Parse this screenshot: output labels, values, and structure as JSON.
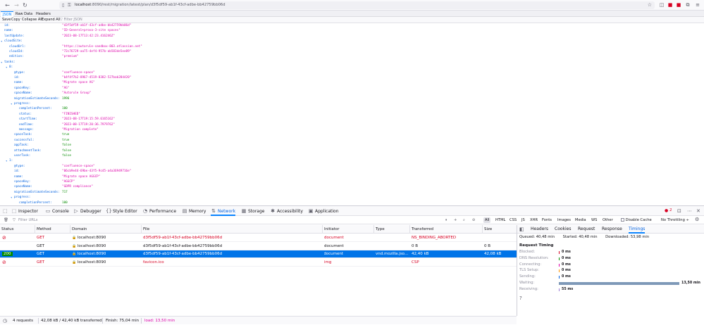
{
  "browser": {
    "url": "localhost:8090/rest/migration/latest/plan/d3f5df59-ab1f-43cf-adbe-bb42759bb06d",
    "url_host": "localhost",
    "url_path": ":8090/rest/migration/latest/plan/d3f5df59-ab1f-43cf-adbe-bb42759bb06d"
  },
  "json_viewer": {
    "tabs": [
      "JSON",
      "Raw Data",
      "Headers"
    ],
    "active_tab": "JSON",
    "toolbar": [
      "Save",
      "Copy",
      "Collapse All",
      "Expand All"
    ],
    "filter_placeholder": "Filter JSON",
    "rows": [
      {
        "indent": 0,
        "key": "id:",
        "value": "\"d3f5df59-ab1f-43cf-adbe-bb42759bb06d\"",
        "type": "str"
      },
      {
        "indent": 0,
        "key": "name:",
        "value": "\"ID-General+prova-3-site spaces\"",
        "type": "str"
      },
      {
        "indent": 0,
        "key": "lastUpdate:",
        "value": "\"2023-08-17T13:42:23.416246Z\"",
        "type": "str"
      },
      {
        "indent": 0,
        "key": "cloudSite:",
        "value": "",
        "type": "obj",
        "twisty": true
      },
      {
        "indent": 1,
        "key": "cloudUrl:",
        "value": "\"https://autorule-sandbox-803.atlassian.net\"",
        "type": "str"
      },
      {
        "indent": 1,
        "key": "cloudId:",
        "value": "\"72c76729-aa75-4ef4-957b-ab583de5ee89\"",
        "type": "str"
      },
      {
        "indent": 1,
        "key": "edition:",
        "value": "\"premium\"",
        "type": "str"
      },
      {
        "indent": 0,
        "key": "tasks:",
        "value": "",
        "type": "obj",
        "twisty": true
      },
      {
        "indent": 1,
        "key": "0:",
        "value": "",
        "type": "obj",
        "twisty": true
      },
      {
        "indent": 2,
        "key": "@type:",
        "value": "\"confluence-space\"",
        "type": "str"
      },
      {
        "indent": 2,
        "key": "id:",
        "value": "\"b4f4f7b2-8967-4519-8382-527bab284420\"",
        "type": "str"
      },
      {
        "indent": 2,
        "key": "name:",
        "value": "\"Migrate space AG\"",
        "type": "str"
      },
      {
        "indent": 2,
        "key": "spaceKey:",
        "value": "\"AG\"",
        "type": "str"
      },
      {
        "indent": 2,
        "key": "spaceName:",
        "value": "\"Autorule Group\"",
        "type": "str"
      },
      {
        "indent": 2,
        "key": "migrationEstimateSeconds:",
        "value": "1996",
        "type": "num"
      },
      {
        "indent": 2,
        "key": "progress:",
        "value": "",
        "type": "obj",
        "twisty": true
      },
      {
        "indent": 3,
        "key": "completionPercent:",
        "value": "100",
        "type": "num"
      },
      {
        "indent": 3,
        "key": "status:",
        "value": "\"FINISHED\"",
        "type": "str"
      },
      {
        "indent": 3,
        "key": "startTime:",
        "value": "\"2023-08-17T19:15:59.6165162\"",
        "type": "str"
      },
      {
        "indent": 3,
        "key": "endTime:",
        "value": "\"2023-08-17T19:20:36.7979762\"",
        "type": "str"
      },
      {
        "indent": 3,
        "key": "message:",
        "value": "\"Migration complete\"",
        "type": "str"
      },
      {
        "indent": 2,
        "key": "spaceTask:",
        "value": "true",
        "type": "num"
      },
      {
        "indent": 2,
        "key": "successful:",
        "value": "true",
        "type": "num"
      },
      {
        "indent": 2,
        "key": "appTask:",
        "value": "false",
        "type": "num"
      },
      {
        "indent": 2,
        "key": "attachmentTask:",
        "value": "false",
        "type": "num"
      },
      {
        "indent": 2,
        "key": "userTask:",
        "value": "false",
        "type": "num"
      },
      {
        "indent": 1,
        "key": "1:",
        "value": "",
        "type": "obj",
        "twisty": true
      },
      {
        "indent": 2,
        "key": "@type:",
        "value": "\"confluence-space\"",
        "type": "str"
      },
      {
        "indent": 2,
        "key": "id:",
        "value": "\"06cb9e44-69be-43f5-9c45-a4a36949716e\"",
        "type": "str"
      },
      {
        "indent": 2,
        "key": "name:",
        "value": "\"Migrate space AGGCP\"",
        "type": "str"
      },
      {
        "indent": 2,
        "key": "spaceKey:",
        "value": "\"AGGCP\"",
        "type": "str"
      },
      {
        "indent": 2,
        "key": "spaceName:",
        "value": "\"GDPR compliance\"",
        "type": "str"
      },
      {
        "indent": 2,
        "key": "migrationEstimateSeconds:",
        "value": "717",
        "type": "num"
      },
      {
        "indent": 2,
        "key": "progress:",
        "value": "",
        "type": "obj",
        "twisty": true
      },
      {
        "indent": 3,
        "key": "completionPercent:",
        "value": "100",
        "type": "num"
      }
    ]
  },
  "devtools": {
    "tabs": [
      {
        "label": "Inspector",
        "icon": "inspector-icon",
        "glyph": "⬚"
      },
      {
        "label": "Console",
        "icon": "console-icon",
        "glyph": "▭"
      },
      {
        "label": "Debugger",
        "icon": "debugger-icon",
        "glyph": "▷"
      },
      {
        "label": "Style Editor",
        "icon": "style-editor-icon",
        "glyph": "{}"
      },
      {
        "label": "Performance",
        "icon": "performance-icon",
        "glyph": "◔"
      },
      {
        "label": "Memory",
        "icon": "memory-icon",
        "glyph": "▤"
      },
      {
        "label": "Network",
        "icon": "network-icon",
        "glyph": "⇅"
      },
      {
        "label": "Storage",
        "icon": "storage-icon",
        "glyph": "▦"
      },
      {
        "label": "Accessibility",
        "icon": "accessibility-icon",
        "glyph": "✱"
      },
      {
        "label": "Application",
        "icon": "application-icon",
        "glyph": "▣"
      }
    ],
    "active_tab": "Network",
    "error_count": "2",
    "filter_placeholder": "Filter URLs",
    "type_filters": [
      "All",
      "HTML",
      "CSS",
      "JS",
      "XHR",
      "Fonts",
      "Images",
      "Media",
      "WS",
      "Other"
    ],
    "disable_cache_label": "Disable Cache",
    "throttling_label": "No Throttling ÷"
  },
  "network_table": {
    "columns": [
      "Status",
      "Method",
      "Domain",
      "File",
      "Initiator",
      "Type",
      "Transferred",
      "Size"
    ],
    "rows": [
      {
        "status": "",
        "status_icon": "blocked-icon",
        "method": "GET",
        "domain": "localhost:8090",
        "file": "d3f5df59-ab1f-43cf-adbe-bb42759bb06d",
        "initiator": "document",
        "type": "",
        "transferred": "NS_BINDING_ABORTED",
        "size": "",
        "error": true,
        "selected": false
      },
      {
        "status": "",
        "status_icon": "",
        "method": "GET",
        "domain": "localhost:8090",
        "file": "d3f5df59-ab1f-43cf-adbe-bb42759bb06d",
        "initiator": "document",
        "type": "",
        "transferred": "0 B",
        "size": "0 B",
        "error": false,
        "selected": false
      },
      {
        "status": "200",
        "status_icon": "",
        "method": "GET",
        "domain": "localhost:8090",
        "file": "d3f5df59-ab1f-43cf-adbe-bb42759bb06d",
        "initiator": "document",
        "type": "vnd.mozilla.jso...",
        "transferred": "42,40 kB",
        "size": "42,08 kB",
        "error": false,
        "selected": true
      },
      {
        "status": "",
        "status_icon": "blocked-icon",
        "method": "GET",
        "domain": "localhost:8090",
        "file": "favicon.ico",
        "initiator": "img",
        "type": "",
        "transferred": "CSP",
        "size": "",
        "error": true,
        "selected": false
      }
    ]
  },
  "side_panel": {
    "tabs": [
      "Headers",
      "Cookies",
      "Request",
      "Response",
      "Timings"
    ],
    "active_tab": "Timings",
    "queued": "Queued: 40,48 min",
    "started": "Started: 40,48 min",
    "downloaded": "Downloaded: 53,98 min",
    "section_title": "Request Timing",
    "timings": [
      {
        "label": "Blocked:",
        "value": "0 ms",
        "fraction": 0.0,
        "color": "#d70022"
      },
      {
        "label": "DNS Resolution:",
        "value": "0 ms",
        "fraction": 0.0,
        "color": "#058b00"
      },
      {
        "label": "Connecting:",
        "value": "0 ms",
        "fraction": 0.0,
        "color": "#dd00a9"
      },
      {
        "label": "TLS Setup:",
        "value": "0 ms",
        "fraction": 0.0,
        "color": "#ff9400"
      },
      {
        "label": "Sending:",
        "value": "0 ms",
        "fraction": 0.0,
        "color": "#0060df"
      },
      {
        "label": "Waiting:",
        "value": "13,50 min",
        "fraction": 1.0,
        "color": "#7e99b8"
      },
      {
        "label": "Receiving:",
        "value": "55 ms",
        "fraction": 0.0,
        "color": "#9b7cd6"
      }
    ]
  },
  "status_bar": {
    "requests": "4 requests",
    "transferred": "42,08 kB / 42,40 kB transferred",
    "finish": "Finish: 75,04 min",
    "load": "load: 13,50 min",
    "load_color": "#dd00a9"
  }
}
